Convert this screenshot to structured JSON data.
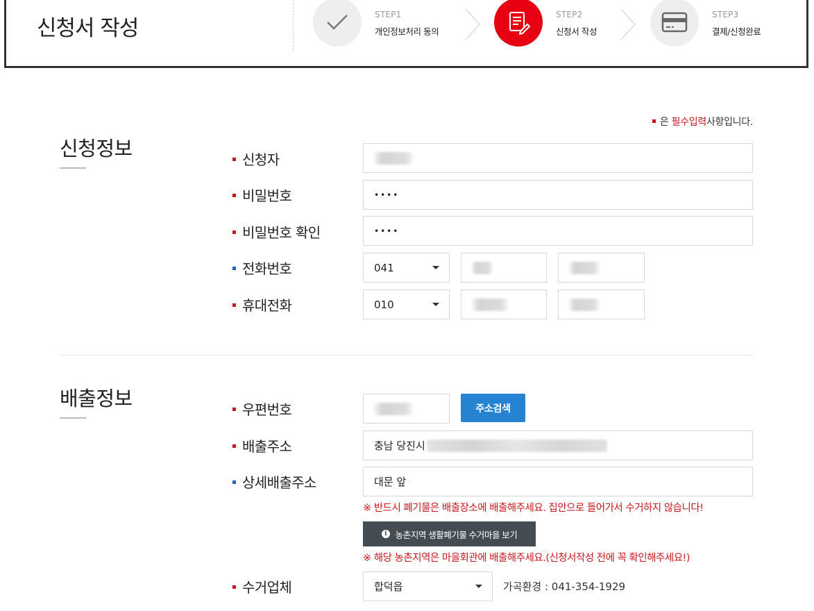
{
  "header": {
    "title": "신청서 작성",
    "steps": [
      {
        "num": "STEP1",
        "label": "개인정보처리 동의",
        "icon": "check-icon",
        "state": "done"
      },
      {
        "num": "STEP2",
        "label": "신청서 작성",
        "icon": "form-edit-icon",
        "state": "active"
      },
      {
        "num": "STEP3",
        "label": "결제/신청완료",
        "icon": "card-icon",
        "state": "pending"
      }
    ]
  },
  "required_note": {
    "prefix": "은 ",
    "highlight": "필수입력",
    "suffix": "사항입니다."
  },
  "applicant_section": {
    "title": "신청정보",
    "applicant": {
      "label": "신청자",
      "value": ""
    },
    "password": {
      "label": "비밀번호",
      "value": "••••"
    },
    "password_confirm": {
      "label": "비밀번호 확인",
      "value": "••••"
    },
    "phone": {
      "label": "전화번호",
      "prefix": "041",
      "middle": "",
      "last": ""
    },
    "mobile": {
      "label": "휴대전화",
      "prefix": "010",
      "middle": "",
      "last": ""
    }
  },
  "discharge_section": {
    "title": "배출정보",
    "postcode": {
      "label": "우편번호",
      "value": "",
      "search_button": "주소검색"
    },
    "address": {
      "label": "배출주소",
      "value": "충남 당진시"
    },
    "detail_address": {
      "label": "상세배출주소",
      "value": "대문 앞"
    },
    "warning1": "※ 반드시 폐기물은 배출장소에 배출해주세요. 집안으로 들어가서 수거하지 않습니다!",
    "rural_button": "농촌지역 생활폐기물 수거마을 보기",
    "warning2": "※ 해당 농촌지역은 마을회관에 배출해주세요.(신청서작성 전에 꼭 확인해주세요!)",
    "collector": {
      "label": "수거업체",
      "value": "합덕읍",
      "phone": "가곡환경 : 041-354-1929"
    }
  },
  "colors": {
    "accent_red": "#e60012",
    "required_dot": "#c8161d",
    "optional_dot": "#2b62b5",
    "button_blue": "#2683d2",
    "button_dark": "#444b53"
  }
}
